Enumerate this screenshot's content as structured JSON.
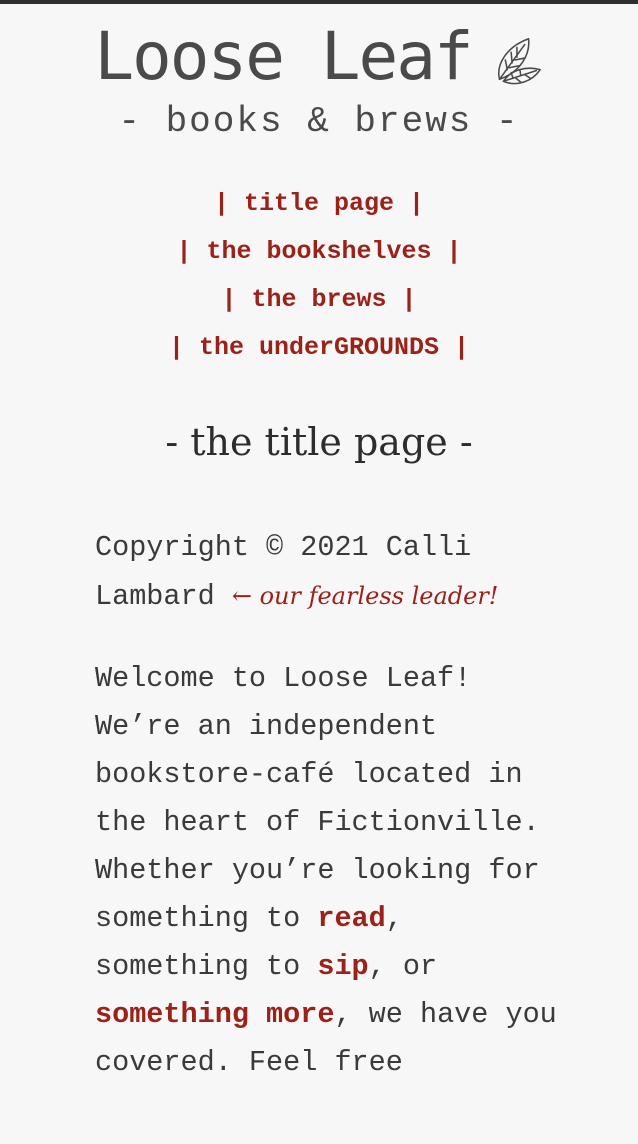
{
  "header": {
    "title": "Loose Leaf",
    "tagline": "- books & brews -",
    "logo_icon": "leaf-icon"
  },
  "nav": {
    "items": [
      {
        "label": "| title page |"
      },
      {
        "label": "| the bookshelves |"
      },
      {
        "label": "| the brews |"
      },
      {
        "label": "| the underGROUNDS |"
      }
    ]
  },
  "page": {
    "heading": "- the title page -"
  },
  "copyright": {
    "text": "Copyright © 2021 Calli Lambard ",
    "note": "← our fearless leader!"
  },
  "welcome": {
    "part1": "Welcome to Loose Leaf! We’re an independent bookstore-café located in the heart of Fictionville. Whether you’re looking for something to ",
    "link_read": "read",
    "part2": ", something to ",
    "link_sip": "sip",
    "part3": ", or ",
    "link_more": "something more",
    "part4": ", we have you covered. Feel free"
  },
  "colors": {
    "accent": "#9b2218",
    "text": "#3a3a3a",
    "background": "#f7f7f7",
    "topbar": "#2f2f2f"
  }
}
